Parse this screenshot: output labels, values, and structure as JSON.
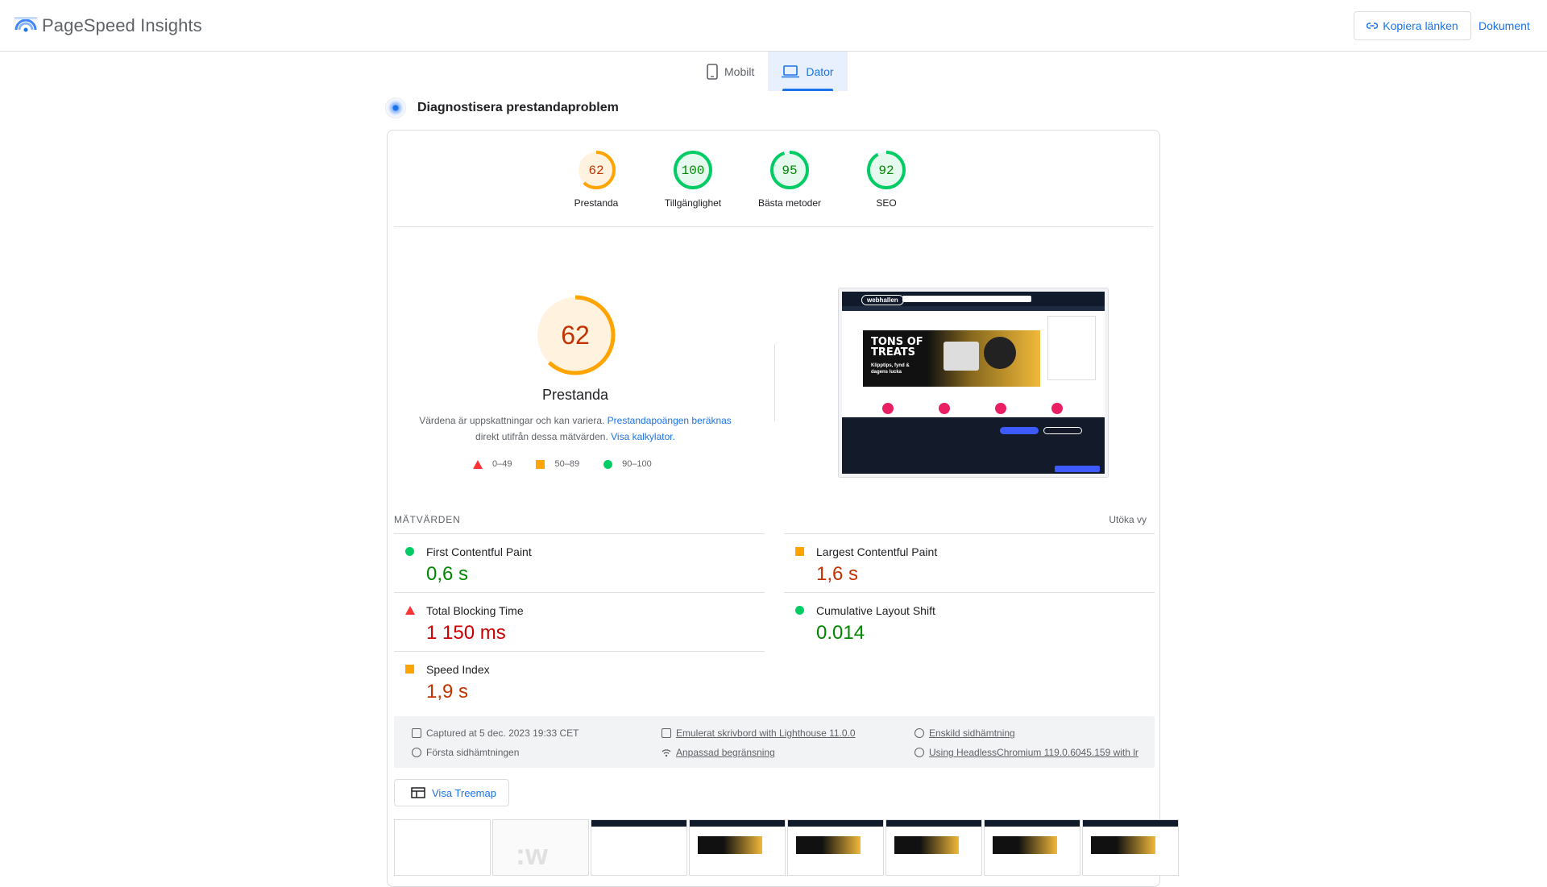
{
  "header": {
    "brand": "PageSpeed Insights",
    "copy_link_label": "Kopiera länken",
    "docs_label": "Dokument"
  },
  "tabs": [
    {
      "label": "Mobilt",
      "icon": "phone-icon",
      "active": false
    },
    {
      "label": "Dator",
      "icon": "laptop-icon",
      "active": true
    }
  ],
  "diagnose": {
    "title": "Diagnostisera prestandaproblem"
  },
  "categories": [
    {
      "label": "Prestanda",
      "score": "62",
      "score_value": 62,
      "rating": "average",
      "color": "#ffa400"
    },
    {
      "label": "Tillgänglighet",
      "score": "100",
      "score_value": 100,
      "rating": "pass",
      "color": "#0c6"
    },
    {
      "label": "Bästa metoder",
      "score": "95",
      "score_value": 95,
      "rating": "pass",
      "color": "#0c6"
    },
    {
      "label": "SEO",
      "score": "92",
      "score_value": 92,
      "rating": "pass",
      "color": "#0c6"
    }
  ],
  "performance": {
    "score": "62",
    "score_value": 62,
    "label": "Prestanda",
    "note_text": "Värdena är uppskattningar och kan variera. ",
    "note_link1": "Prestandapoängen beräknas",
    "note_text2": " direkt utifrån dessa mätvärden. ",
    "note_link2": "Visa kalkylator.",
    "legend": [
      {
        "shape": "triangle",
        "range": "0–49",
        "color": "#ff3333"
      },
      {
        "shape": "square",
        "range": "50–89",
        "color": "#ffa400"
      },
      {
        "shape": "circle",
        "range": "90–100",
        "color": "#00cc66"
      }
    ]
  },
  "screenshot": {
    "site_logo": "webhallen",
    "hero_title": "TONS OF TREATS",
    "hero_subtitle": "Klipptips, fynd & dagens lucka"
  },
  "metrics": {
    "heading": "MÄTVÄRDEN",
    "expand_label": "Utöka vy",
    "items": [
      {
        "name": "First Contentful Paint",
        "value": "0,6 s",
        "rating": "pass"
      },
      {
        "name": "Largest Contentful Paint",
        "value": "1,6 s",
        "rating": "average"
      },
      {
        "name": "Total Blocking Time",
        "value": "1 150 ms",
        "rating": "fail"
      },
      {
        "name": "Cumulative Layout Shift",
        "value": "0.014",
        "rating": "pass"
      },
      {
        "name": "Speed Index",
        "value": "1,9 s",
        "rating": "average"
      }
    ]
  },
  "run_info": {
    "captured": "Captured at 5 dec. 2023 19:33 CET",
    "first_load": "Första sidhämtningen",
    "emulated": "Emulerat skrivbord with Lighthouse 11.0.0",
    "throttling": "Anpassad begränsning",
    "single_load": "Enskild sidhämtning",
    "browser": "Using HeadlessChromium 119.0.6045.159 with lr"
  },
  "treemap": {
    "label": "Visa Treemap"
  },
  "filmstrip": {
    "watermark": ":w"
  }
}
